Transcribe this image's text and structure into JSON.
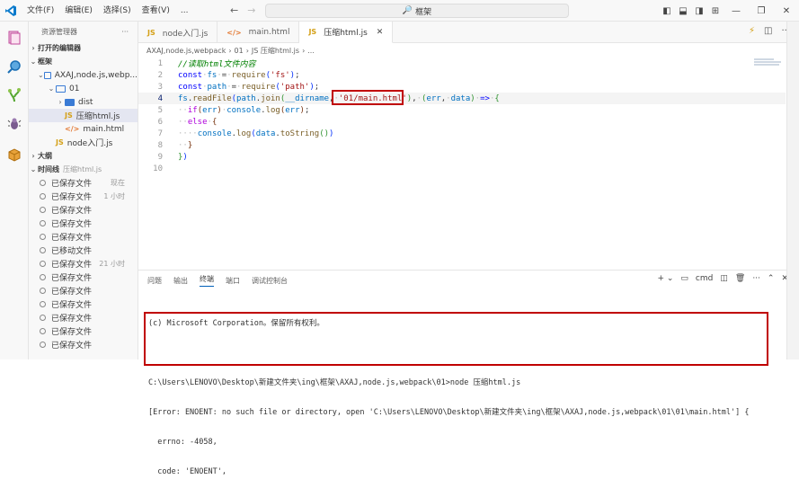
{
  "menu": [
    "文件(F)",
    "编辑(E)",
    "选择(S)",
    "查看(V)",
    "..."
  ],
  "search": {
    "text": "框架"
  },
  "sidebar": {
    "header": "资源管理器",
    "open_editors": "打开的编辑器",
    "root": "框架",
    "tree": [
      {
        "label": "AXAJ,node.js,webp...",
        "indent": 1,
        "type": "folder-open"
      },
      {
        "label": "01",
        "indent": 2,
        "type": "folder-open"
      },
      {
        "label": "dist",
        "indent": 3,
        "type": "folder-closed"
      },
      {
        "label": "压缩html.js",
        "indent": 3,
        "type": "js",
        "selected": true
      },
      {
        "label": "main.html",
        "indent": 3,
        "type": "html"
      },
      {
        "label": "node入门.js",
        "indent": 2,
        "type": "js"
      }
    ],
    "outline": "大纲",
    "timeline_label": "时间线",
    "timeline_file": "压缩html.js",
    "timeline": [
      {
        "label": "已保存文件",
        "time": "现在"
      },
      {
        "label": "已保存文件",
        "time": "1 小时"
      },
      {
        "label": "已保存文件",
        "time": ""
      },
      {
        "label": "已保存文件",
        "time": ""
      },
      {
        "label": "已保存文件",
        "time": ""
      },
      {
        "label": "已移动文件",
        "time": ""
      },
      {
        "label": "已保存文件",
        "time": "21 小时"
      },
      {
        "label": "已保存文件",
        "time": ""
      },
      {
        "label": "已保存文件",
        "time": ""
      },
      {
        "label": "已保存文件",
        "time": ""
      },
      {
        "label": "已保存文件",
        "time": ""
      },
      {
        "label": "已保存文件",
        "time": ""
      },
      {
        "label": "已保存文件",
        "time": ""
      }
    ]
  },
  "tabs": [
    {
      "icon": "JS",
      "label": "node入门.js",
      "active": false
    },
    {
      "icon": "</>",
      "label": "main.html",
      "active": false
    },
    {
      "icon": "JS",
      "label": "压缩html.js",
      "active": true
    }
  ],
  "breadcrumb": [
    "AXAJ,node.js,webpack",
    "01",
    "JS 压缩html.js",
    "..."
  ],
  "code": {
    "line_numbers": [
      "1",
      "2",
      "3",
      "4",
      "5",
      "6",
      "7",
      "8",
      "9",
      "10"
    ],
    "l1": "//读取html文件内容",
    "l4_arg": "01/main.html"
  },
  "panel": {
    "tabs": [
      "问题",
      "输出",
      "终端",
      "端口",
      "调试控制台"
    ],
    "active_tab": "终端",
    "shell": "cmd",
    "lines": [
      "(c) Microsoft Corporation。保留所有权利。",
      "",
      "C:\\Users\\LENOVO\\Desktop\\新建文件夹\\ing\\框架\\AXAJ,node.js,webpack\\01>node 压缩html.js",
      "[Error: ENOENT: no such file or directory, open 'C:\\Users\\LENOVO\\Desktop\\新建文件夹\\ing\\框架\\AXAJ,node.js,webpack\\01\\01\\main.html'] {",
      "  errno: -4058,",
      "  code: 'ENOENT',"
    ]
  },
  "colors": {
    "accent": "#005fb8",
    "highlight_box": "#c00000"
  }
}
